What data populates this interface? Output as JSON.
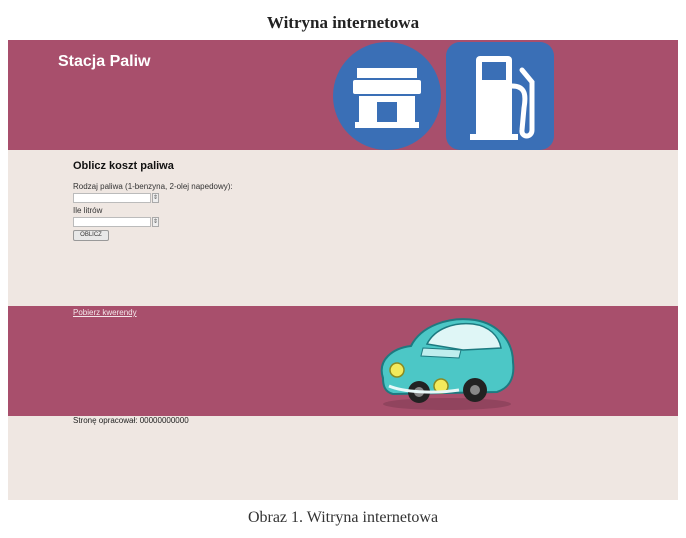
{
  "document": {
    "title": "Witryna internetowa",
    "caption": "Obraz 1. Witryna internetowa"
  },
  "banner": {
    "title": "Stacja Paliw",
    "icons": [
      "shop-icon",
      "fuel-pump-icon"
    ],
    "background": "#a84f6c"
  },
  "form": {
    "title": "Oblicz koszt paliwa",
    "fuel_type_label": "Rodzaj paliwa (1-benzyna, 2-olej napedowy):",
    "fuel_type_value": "",
    "liters_label": "Ile litrów",
    "liters_value": "",
    "submit_label": "OBLICZ"
  },
  "middle": {
    "link_text": "Pobierz kwerendy",
    "image": "car-icon"
  },
  "footer": {
    "text": "Stronę opracował: 00000000000"
  },
  "colors": {
    "accent": "#a84f6c",
    "page_background": "#efe7e2",
    "icon_blue": "#3a6fb6"
  }
}
